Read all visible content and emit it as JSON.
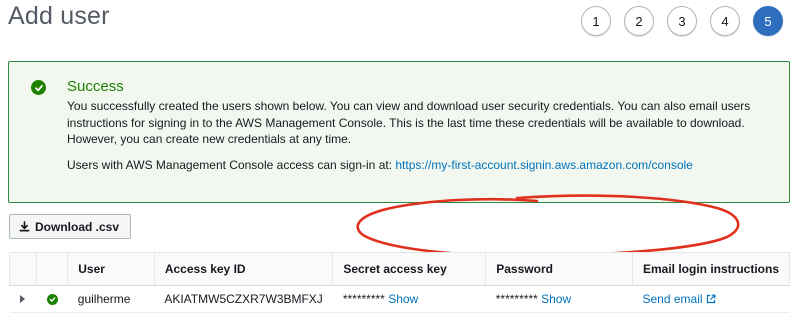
{
  "page": {
    "title": "Add user"
  },
  "steps": [
    "1",
    "2",
    "3",
    "4",
    "5"
  ],
  "alert": {
    "title": "Success",
    "message": "You successfully created the users shown below. You can view and download user security credentials. You can also email users instructions for signing in to the AWS Management Console. This is the last time these credentials will be available to download. However, you can create new credentials at any time.",
    "signin_prefix": "Users with AWS Management Console access can sign-in at: ",
    "signin_url": "https://my-first-account.signin.aws.amazon.com/console"
  },
  "toolbar": {
    "download_label": "Download .csv"
  },
  "table": {
    "headers": [
      "User",
      "Access key ID",
      "Secret access key",
      "Password",
      "Email login instructions"
    ],
    "rows": [
      {
        "user": "guilherme",
        "access_key_id": "AKIATMW5CZXR7W3BMFXJ",
        "secret_mask": "*********",
        "secret_action": "Show",
        "password_mask": "*********",
        "password_action": "Show",
        "email_action": "Send email"
      }
    ]
  },
  "colors": {
    "success": "#1d8102",
    "link": "#0073bb",
    "active_step": "#2f6ebf",
    "annotation": "#e0301e"
  },
  "icons": {
    "success": "check-circle-icon",
    "download": "download-icon",
    "external": "external-link-icon",
    "expand": "caret-right-icon"
  }
}
